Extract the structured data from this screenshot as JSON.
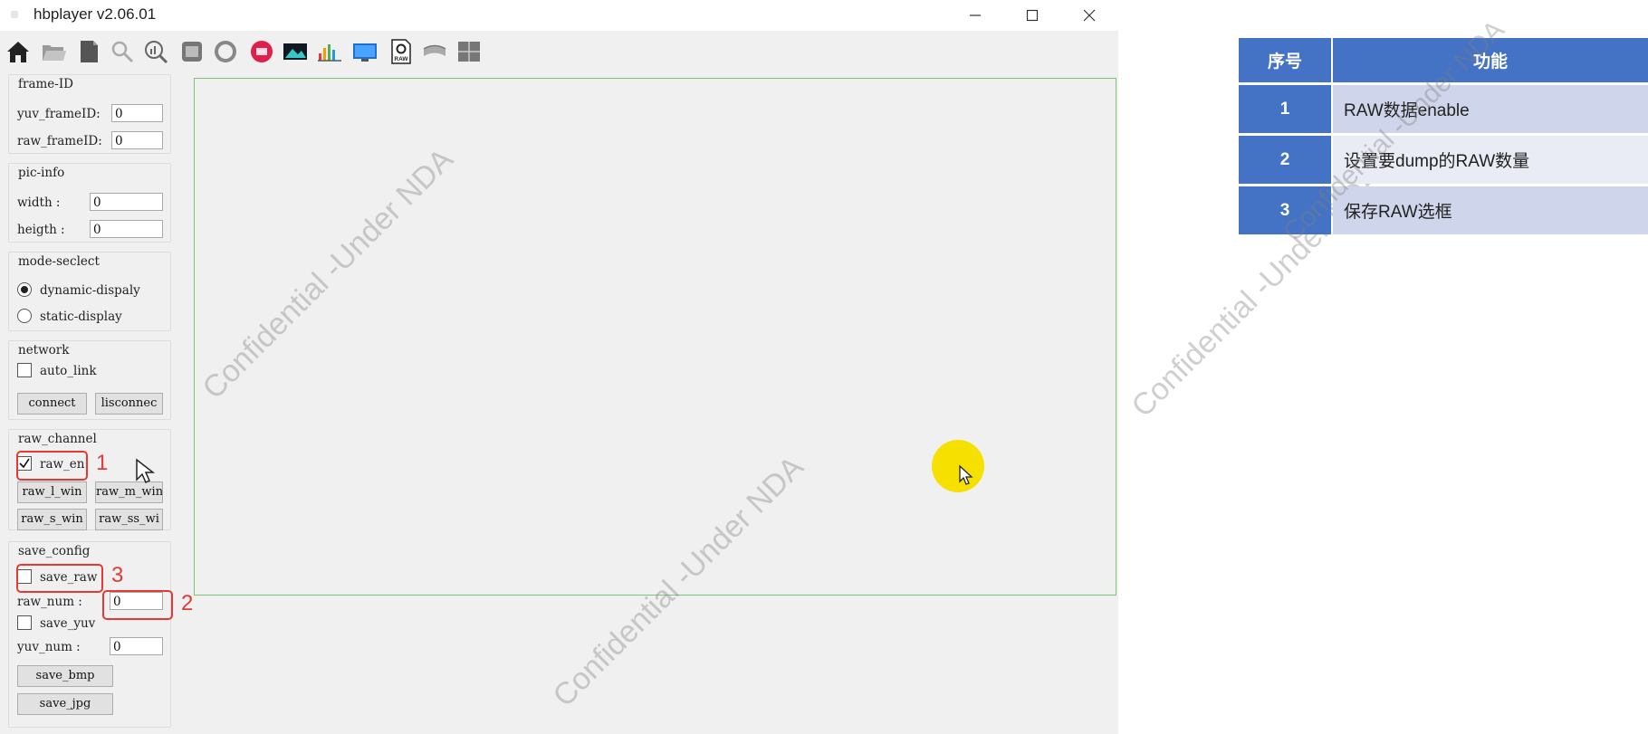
{
  "window": {
    "title": "hbplayer v2.06.01",
    "controls": [
      "minimize",
      "maximize",
      "close"
    ]
  },
  "toolbar": {
    "icons": [
      "home-icon",
      "open-folder-icon",
      "document-icon",
      "search-icon",
      "zoom-chart-icon",
      "frame-icon",
      "refresh-icon",
      "record-icon",
      "image-icon",
      "histogram-icon",
      "monitor-icon",
      "raw-file-icon",
      "calibration-icon",
      "grid-icon"
    ],
    "raw_icon_text": "RAW"
  },
  "frame_id": {
    "title": "frame-ID",
    "yuv_label": "yuv_frameID:",
    "yuv_value": "0",
    "raw_label": "raw_frameID:",
    "raw_value": "0"
  },
  "pic_info": {
    "title": "pic-info",
    "width_label": "width :",
    "width_value": "0",
    "height_label": "heigth :",
    "height_value": "0"
  },
  "mode_select": {
    "title": "mode-seclect",
    "dynamic_label": "dynamic-dispaly",
    "static_label": "static-display",
    "selected": "dynamic-dispaly"
  },
  "network": {
    "title": "network",
    "auto_link_label": "auto_link",
    "auto_link_checked": false,
    "connect_label": "connect",
    "disconnect_label": "lisconnec"
  },
  "raw_channel": {
    "title": "raw_channel",
    "raw_en_label": "raw_en",
    "raw_en_checked": true,
    "buttons": [
      "raw_l_win",
      "raw_m_win",
      "raw_s_win",
      "raw_ss_wi"
    ]
  },
  "save_config": {
    "title": "save_config",
    "save_raw_label": "save_raw",
    "save_raw_checked": false,
    "raw_num_label": "raw_num :",
    "raw_num_value": "0",
    "save_yuv_label": "save_yuv",
    "save_yuv_checked": false,
    "yuv_num_label": "yuv_num :",
    "yuv_num_value": "0",
    "save_bmp_label": "save_bmp",
    "save_jpg_label": "save_jpg"
  },
  "annotations": {
    "n1": "1",
    "n2": "2",
    "n3": "3",
    "color": "#e53935"
  },
  "watermarks": [
    "Confidential -Under NDA",
    "Confidential -Under NDA",
    "Confidential -Under NDA",
    "Confidential -Under NDA"
  ],
  "feature_table": {
    "headers": [
      "序号",
      "功能"
    ],
    "rows": [
      {
        "num": "1",
        "text": "RAW数据enable"
      },
      {
        "num": "2",
        "text": "设置要dump的RAW数量"
      },
      {
        "num": "3",
        "text": "保存RAW选框"
      }
    ],
    "header_color": "#4472c4",
    "row_colors": [
      "#cfd5ea",
      "#e9ebf5",
      "#cfd5ea"
    ]
  }
}
